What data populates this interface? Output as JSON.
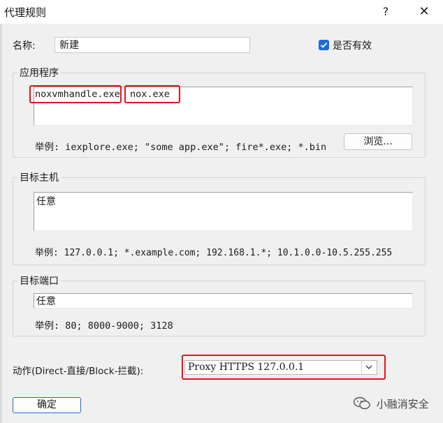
{
  "window": {
    "title": "代理规则",
    "help_label": "?",
    "close_label": "✕"
  },
  "name_row": {
    "label": "名称:",
    "value": "新建",
    "enabled_label": "是否有效",
    "enabled_checked": true
  },
  "applications": {
    "group_title": "应用程序",
    "entries": [
      "noxvmhandle.exe",
      "nox.exe"
    ],
    "example": "举例: iexplore.exe; \"some app.exe\"; fire*.exe; *.bin",
    "browse_label": "浏览..."
  },
  "target_hosts": {
    "group_title": "目标主机",
    "value": "任意",
    "example": "举例: 127.0.0.1; *.example.com; 192.168.1.*; 10.1.0.0-10.5.255.255"
  },
  "target_ports": {
    "group_title": "目标端口",
    "value": "任意",
    "example": "举例: 80; 8000-9000; 3128"
  },
  "action": {
    "label": "动作(Direct-直接/Block-拦截):",
    "selected": "Proxy HTTPS 127.0.0.1"
  },
  "footer": {
    "ok_label": "确定",
    "watermark": "小融消安全"
  },
  "colors": {
    "accent": "#1c6cd4",
    "highlight": "#e0141e"
  }
}
